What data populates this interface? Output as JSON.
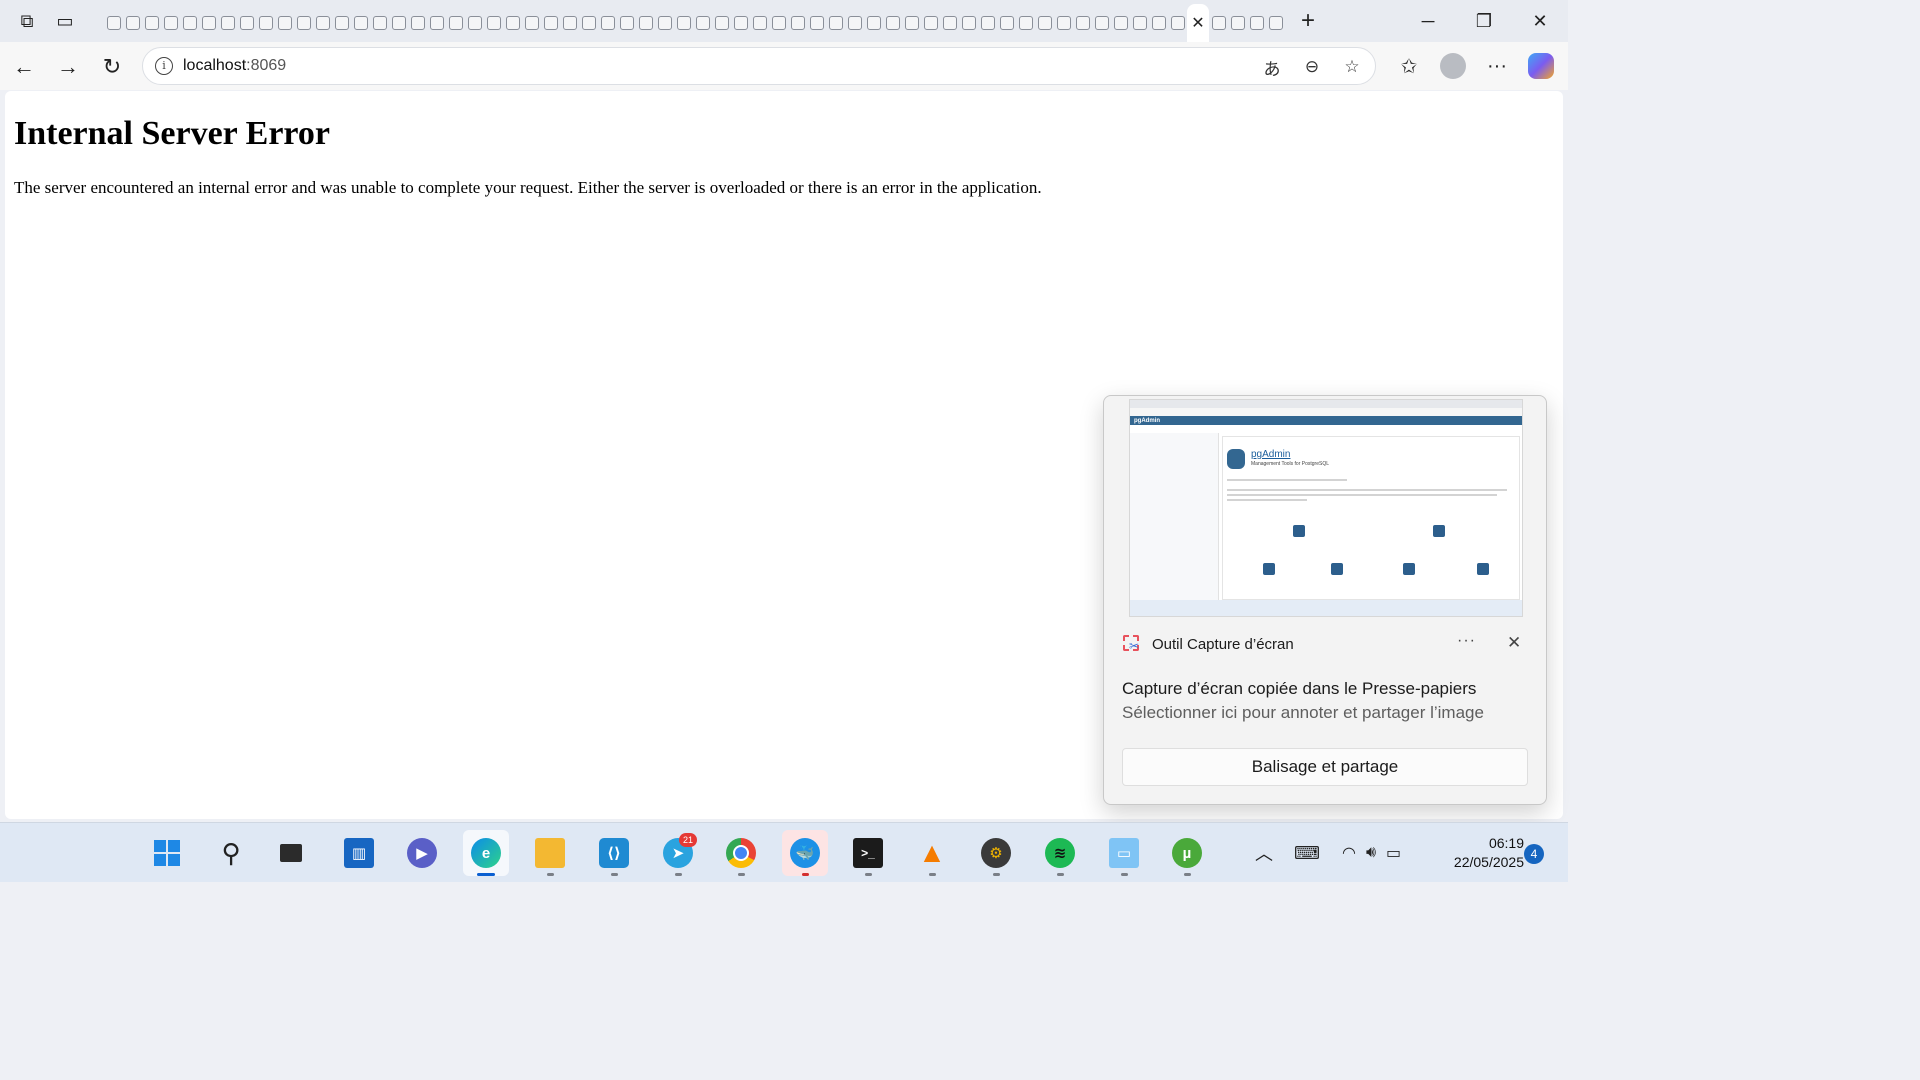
{
  "browser": {
    "active_tab_close": "✕",
    "new_tab": "+",
    "url_host": "localhost",
    "url_port": ":8069",
    "tab_count": 62
  },
  "page": {
    "heading": "Internal Server Error",
    "message": "The server encountered an internal error and was unable to complete your request. Either the server is overloaded or there is an error in the application."
  },
  "toast": {
    "app_name": "Outil Capture d’écran",
    "more": "···",
    "close": "✕",
    "title": "Capture d’écran copiée dans le Presse-papiers",
    "body": "Sélectionner ici pour annoter et partager l’image",
    "action": "Balisage et partage",
    "thumbnail": {
      "app": "pgAdmin",
      "tagline": "Management Tools for PostgreSQL"
    }
  },
  "taskbar": {
    "telegram_badge": "21",
    "time": "06:19",
    "date": "22/05/2025",
    "notifications": "4"
  },
  "colors": {
    "accent": "#0a5fd1",
    "pgadmin_blue": "#326690",
    "error_badge": "#e53935"
  }
}
